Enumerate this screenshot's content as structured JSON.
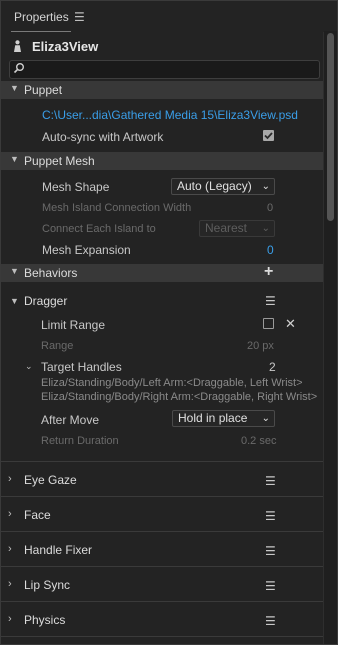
{
  "panel": {
    "title": "Properties",
    "menu_icon": "hamburger-menu-icon"
  },
  "object": {
    "name": "Eliza3View",
    "icon": "puppet-person-icon"
  },
  "search": {
    "placeholder": "",
    "icon": "search-icon"
  },
  "puppet": {
    "section_label": "Puppet",
    "file_path": "C:\\User...dia\\Gathered Media 15\\Eliza3View.psd",
    "autosync_label": "Auto-sync with Artwork",
    "autosync_checked": true
  },
  "puppet_mesh": {
    "section_label": "Puppet Mesh",
    "mesh_shape_label": "Mesh Shape",
    "mesh_shape_value": "Auto (Legacy)",
    "island_width_label": "Mesh Island Connection Width",
    "island_width_value": "0",
    "connect_label": "Connect Each Island to",
    "connect_value": "Nearest",
    "expansion_label": "Mesh Expansion",
    "expansion_value": "0"
  },
  "behaviors": {
    "section_label": "Behaviors",
    "add_icon": "plus-icon",
    "dragger": {
      "label": "Dragger",
      "limit_range_label": "Limit Range",
      "range_label": "Range",
      "range_value": "20 px",
      "target_handles_label": "Target Handles",
      "target_handles_count": "2",
      "handles": [
        "Eliza/Standing/Body/Left Arm:<Draggable, Left Wrist>",
        "Eliza/Standing/Body/Right Arm:<Draggable, Right Wrist>"
      ],
      "after_move_label": "After Move",
      "after_move_value": "Hold in place",
      "return_duration_label": "Return Duration",
      "return_duration_value": "0.2 sec"
    },
    "items": [
      {
        "label": "Eye Gaze"
      },
      {
        "label": "Face"
      },
      {
        "label": "Handle Fixer"
      },
      {
        "label": "Lip Sync"
      },
      {
        "label": "Physics"
      }
    ]
  },
  "colors": {
    "accent": "#3a9ee8",
    "section_bg": "#383838",
    "panel_bg": "#232323"
  }
}
